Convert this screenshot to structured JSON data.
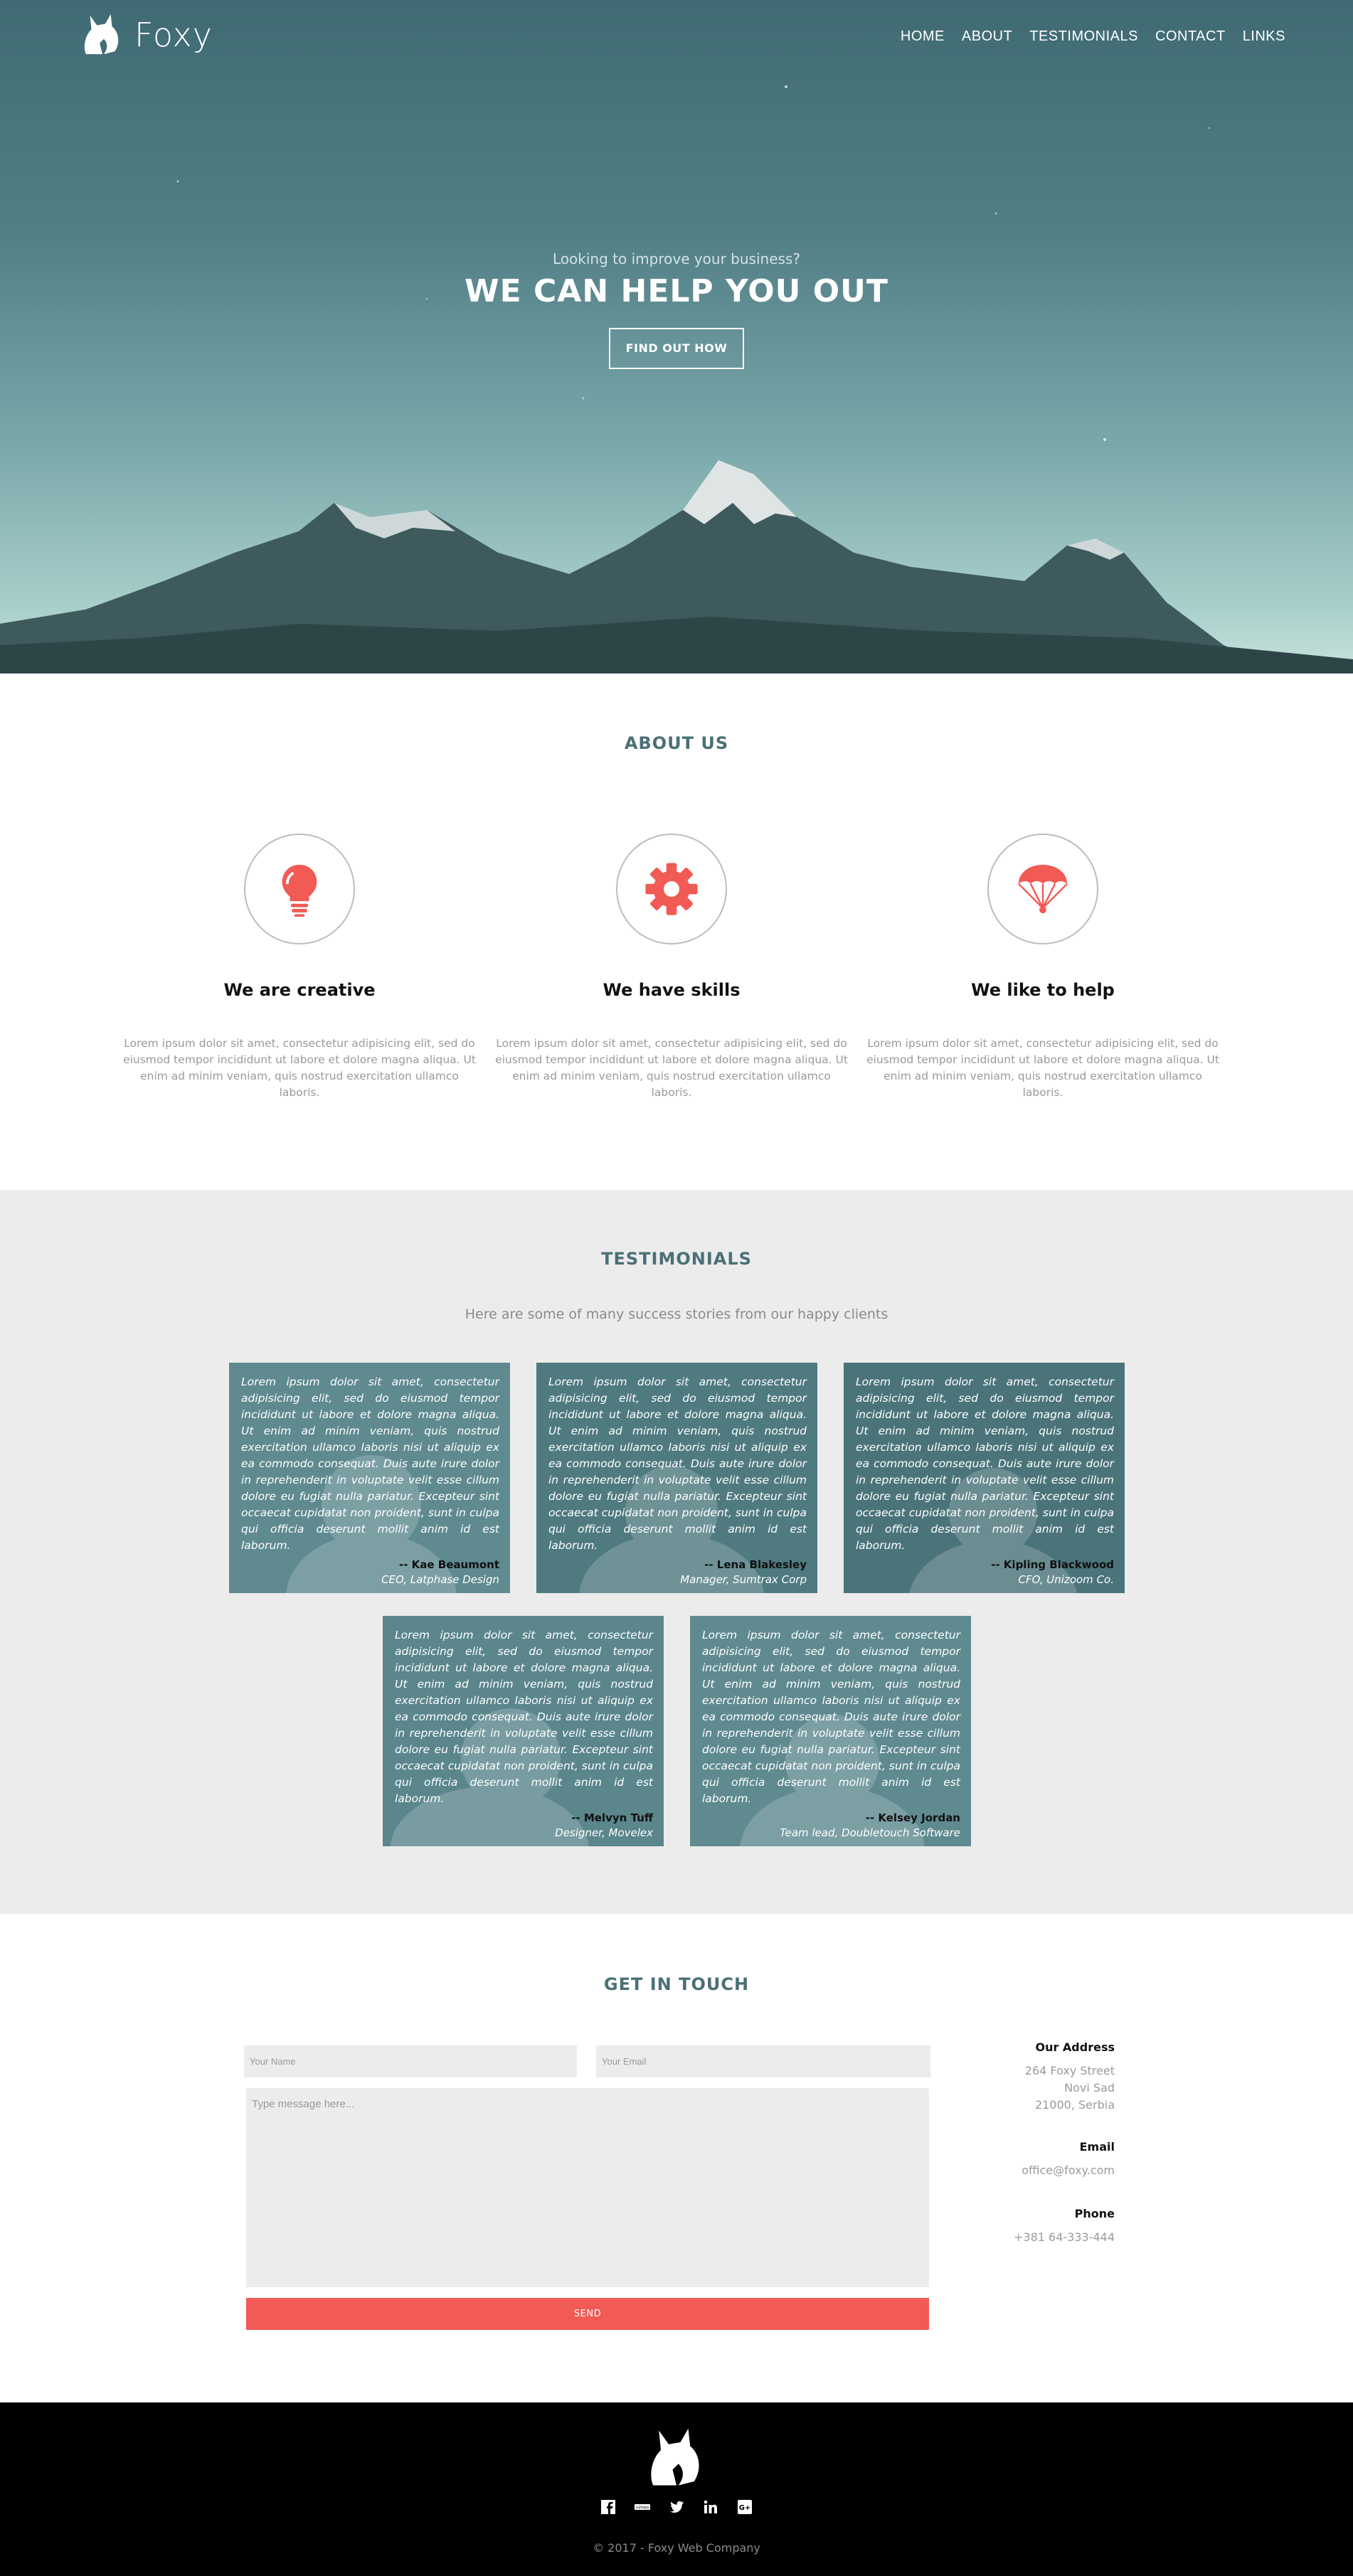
{
  "nav": {
    "brand": "Foxy",
    "links": [
      "HOME",
      "ABOUT",
      "TESTIMONIALS",
      "CONTACT",
      "LINKS"
    ]
  },
  "hero": {
    "subtitle": "Looking to improve your business?",
    "title": "WE CAN HELP YOU OUT",
    "button": "FIND OUT HOW"
  },
  "about": {
    "title": "ABOUT US",
    "features": [
      {
        "icon": "lightbulb-icon",
        "title": "We are creative",
        "text": "Lorem ipsum dolor sit amet, consectetur adipisicing elit, sed do eiusmod tempor incididunt ut labore et dolore magna aliqua. Ut enim ad minim veniam, quis nostrud exercitation ullamco laboris."
      },
      {
        "icon": "gear-icon",
        "title": "We have skills",
        "text": "Lorem ipsum dolor sit amet, consectetur adipisicing elit, sed do eiusmod tempor incididunt ut labore et dolore magna aliqua. Ut enim ad minim veniam, quis nostrud exercitation ullamco laboris."
      },
      {
        "icon": "parachute-icon",
        "title": "We like to help",
        "text": "Lorem ipsum dolor sit amet, consectetur adipisicing elit, sed do eiusmod tempor incididunt ut labore et dolore magna aliqua. Ut enim ad minim veniam, quis nostrud exercitation ullamco laboris."
      }
    ]
  },
  "testimonials": {
    "title": "TESTIMONIALS",
    "intro": "Here are some of many success stories from our happy clients",
    "items": [
      {
        "quote": "Lorem ipsum dolor sit amet, consectetur adipisicing elit, sed do eiusmod tempor incididunt ut labore et dolore magna aliqua. Ut enim ad minim veniam, quis nostrud exercitation ullamco laboris nisi ut aliquip ex ea commodo consequat. Duis aute irure dolor in reprehenderit in voluptate velit esse cillum dolore eu fugiat nulla pariatur. Excepteur sint occaecat cupidatat non proident, sunt in culpa qui officia deserunt mollit anim id est laborum.",
        "author": "-- Kae Beaumont",
        "role": "CEO, Latphase Design"
      },
      {
        "quote": "Lorem ipsum dolor sit amet, consectetur adipisicing elit, sed do eiusmod tempor incididunt ut labore et dolore magna aliqua. Ut enim ad minim veniam, quis nostrud exercitation ullamco laboris nisi ut aliquip ex ea commodo consequat. Duis aute irure dolor in reprehenderit in voluptate velit esse cillum dolore eu fugiat nulla pariatur. Excepteur sint occaecat cupidatat non proident, sunt in culpa qui officia deserunt mollit anim id est laborum.",
        "author": "-- Lena Blakesley",
        "role": "Manager, Sumtrax Corp"
      },
      {
        "quote": "Lorem ipsum dolor sit amet, consectetur adipisicing elit, sed do eiusmod tempor incididunt ut labore et dolore magna aliqua. Ut enim ad minim veniam, quis nostrud exercitation ullamco laboris nisi ut aliquip ex ea commodo consequat. Duis aute irure dolor in reprehenderit in voluptate velit esse cillum dolore eu fugiat nulla pariatur. Excepteur sint occaecat cupidatat non proident, sunt in culpa qui officia deserunt mollit anim id est laborum.",
        "author": "-- Kipling Blackwood",
        "role": "CFO, Unizoom Co."
      },
      {
        "quote": "Lorem ipsum dolor sit amet, consectetur adipisicing elit, sed do eiusmod tempor incididunt ut labore et dolore magna aliqua. Ut enim ad minim veniam, quis nostrud exercitation ullamco laboris nisi ut aliquip ex ea commodo consequat. Duis aute irure dolor in reprehenderit in voluptate velit esse cillum dolore eu fugiat nulla pariatur. Excepteur sint occaecat cupidatat non proident, sunt in culpa qui officia deserunt mollit anim id est laborum.",
        "author": "-- Melvyn Tuff",
        "role": "Designer, Movelex"
      },
      {
        "quote": "Lorem ipsum dolor sit amet, consectetur adipisicing elit, sed do eiusmod tempor incididunt ut labore et dolore magna aliqua. Ut enim ad minim veniam, quis nostrud exercitation ullamco laboris nisi ut aliquip ex ea commodo consequat. Duis aute irure dolor in reprehenderit in voluptate velit esse cillum dolore eu fugiat nulla pariatur. Excepteur sint occaecat cupidatat non proident, sunt in culpa qui officia deserunt mollit anim id est laborum.",
        "author": "-- Kelsey Jordan",
        "role": "Team lead, Doubletouch Software"
      }
    ]
  },
  "contact": {
    "title": "GET IN TOUCH",
    "name_placeholder": "Your Name",
    "email_placeholder": "Your Email",
    "message_placeholder": "Type message here...",
    "send": "SEND",
    "address_label": "Our Address",
    "address_lines": [
      "264 Foxy Street",
      "Novi Sad",
      "21000, Serbia"
    ],
    "email_label": "Email",
    "email": "office@foxy.com",
    "phone_label": "Phone",
    "phone": "+381 64-333-444"
  },
  "footer": {
    "social_icons": [
      "facebook-icon",
      "vimeo-icon",
      "twitter-icon",
      "linkedin-icon",
      "googleplus-icon"
    ],
    "copyright": "© 2017 - Foxy Web Company"
  },
  "colors": {
    "accent": "#f25a55",
    "heading": "#4a7076",
    "card": "#5f8a90",
    "hero_top": "#3f6a73",
    "hero_bottom": "#c9e3dc"
  }
}
